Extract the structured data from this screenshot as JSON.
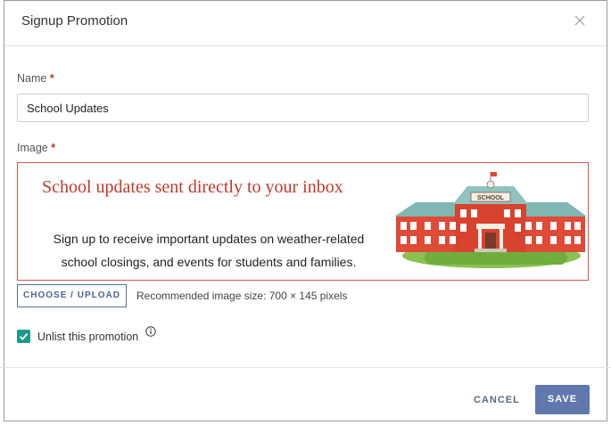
{
  "dialog": {
    "title": "Signup Promotion",
    "close_icon": "close-icon"
  },
  "form": {
    "name_label": "Name",
    "name_required": "*",
    "name_value": "School Updates",
    "image_label": "Image",
    "image_required": "*"
  },
  "promo": {
    "headline": "School updates sent directly to your inbox",
    "body_line1": "Sign up to receive important updates on weather-related",
    "body_line2": "school closings, and events for students and families.",
    "sign_text": "SCHOOL",
    "image_icon": "school-building-illustration"
  },
  "upload": {
    "button_label": "CHOOSE / UPLOAD",
    "recommendation": "Recommended image size: 700 × 145 pixels"
  },
  "unlist": {
    "label": "Unlist this promotion",
    "checked": true,
    "info_icon": "info-icon"
  },
  "footer": {
    "cancel_label": "CANCEL",
    "save_label": "SAVE"
  },
  "colors": {
    "accent": "#5f78ad",
    "required": "#c0392b",
    "checkbox": "#1a9a8a",
    "error_border": "#d9534f"
  }
}
